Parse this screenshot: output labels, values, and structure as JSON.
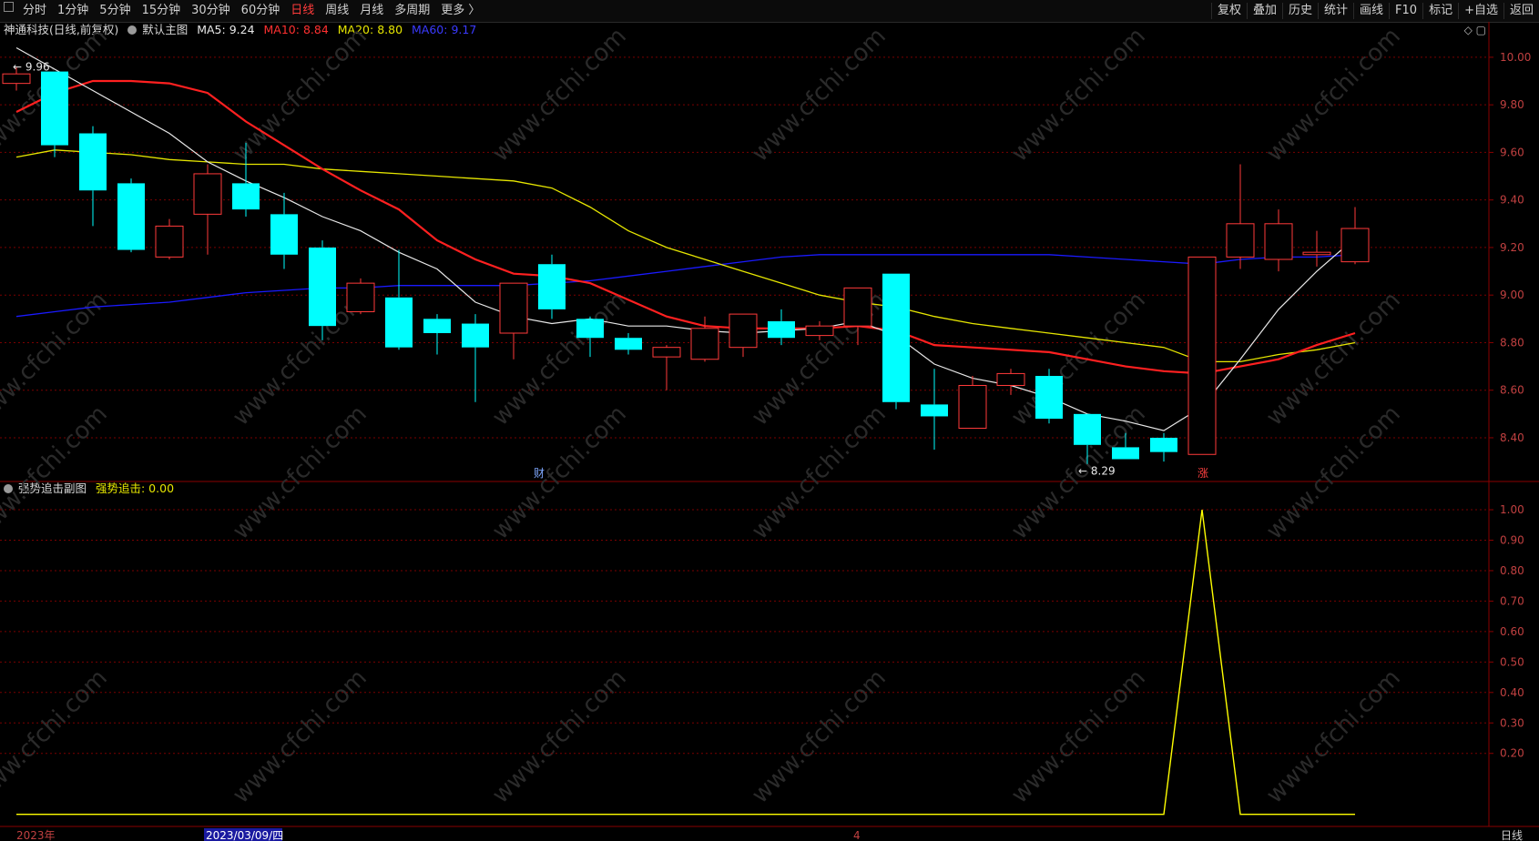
{
  "toolbar": {
    "periods": [
      "分时",
      "1分钟",
      "5分钟",
      "15分钟",
      "30分钟",
      "60分钟",
      "日线",
      "周线",
      "月线",
      "多周期",
      "更多 〉"
    ],
    "active_period": "日线",
    "tools": [
      "复权",
      "叠加",
      "历史",
      "统计",
      "画线",
      "F10",
      "标记",
      "+自选",
      "返回"
    ]
  },
  "main_info": {
    "stock_name": "神通科技(日线,前复权)",
    "indicator_name": "默认主图",
    "ma5": "MA5: 9.24",
    "ma10": "MA10: 8.84",
    "ma20": "MA20: 8.80",
    "ma60": "MA60: 9.17"
  },
  "sub_info": {
    "indicator_name": "强势追击副图",
    "value_label": "强势追击: 0.00"
  },
  "axis": {
    "date_start": "2023年",
    "date_cursor": "2023/03/09/四",
    "month_marker": "4",
    "period_label": "日线"
  },
  "annotations": {
    "high_label": "9.96",
    "low_label": "8.29",
    "finance_marker": "财",
    "limit_up_marker": "涨"
  },
  "watermark": "www.cfchi.com",
  "colors": {
    "up": "#ff3a3a",
    "down": "#00ffff",
    "ma5": "#e8e8e8",
    "ma10": "#ff2020",
    "ma20": "#e6e600",
    "ma60": "#1a1aff",
    "grid": "#7a0000",
    "signal": "#ffff00"
  },
  "chart_data": [
    {
      "type": "candlestick",
      "title": "神通科技(日线,前复权)",
      "y_ticks": [
        "10.00",
        "9.80",
        "9.60",
        "9.40",
        "9.20",
        "9.00",
        "8.80",
        "8.60",
        "8.40"
      ],
      "ylim": [
        8.22,
        10.08
      ],
      "candles": [
        {
          "o": 9.89,
          "c": 9.93,
          "h": 9.96,
          "l": 9.86
        },
        {
          "o": 9.94,
          "c": 9.63,
          "h": 9.94,
          "l": 9.58
        },
        {
          "o": 9.68,
          "c": 9.44,
          "h": 9.71,
          "l": 9.29
        },
        {
          "o": 9.47,
          "c": 9.19,
          "h": 9.49,
          "l": 9.18
        },
        {
          "o": 9.16,
          "c": 9.29,
          "h": 9.32,
          "l": 9.15
        },
        {
          "o": 9.34,
          "c": 9.51,
          "h": 9.55,
          "l": 9.17
        },
        {
          "o": 9.47,
          "c": 9.36,
          "h": 9.64,
          "l": 9.33
        },
        {
          "o": 9.34,
          "c": 9.17,
          "h": 9.43,
          "l": 9.11
        },
        {
          "o": 9.2,
          "c": 8.87,
          "h": 9.23,
          "l": 8.81
        },
        {
          "o": 8.93,
          "c": 9.05,
          "h": 9.07,
          "l": 8.92
        },
        {
          "o": 8.99,
          "c": 8.78,
          "h": 9.19,
          "l": 8.77
        },
        {
          "o": 8.9,
          "c": 8.84,
          "h": 8.92,
          "l": 8.75
        },
        {
          "o": 8.88,
          "c": 8.78,
          "h": 8.92,
          "l": 8.55
        },
        {
          "o": 8.84,
          "c": 9.05,
          "h": 9.05,
          "l": 8.73
        },
        {
          "o": 9.13,
          "c": 8.94,
          "h": 9.17,
          "l": 8.9
        },
        {
          "o": 8.9,
          "c": 8.82,
          "h": 8.91,
          "l": 8.74
        },
        {
          "o": 8.82,
          "c": 8.77,
          "h": 8.84,
          "l": 8.75
        },
        {
          "o": 8.74,
          "c": 8.78,
          "h": 8.79,
          "l": 8.6
        },
        {
          "o": 8.73,
          "c": 8.86,
          "h": 8.91,
          "l": 8.72
        },
        {
          "o": 8.78,
          "c": 8.92,
          "h": 8.92,
          "l": 8.74
        },
        {
          "o": 8.89,
          "c": 8.82,
          "h": 8.94,
          "l": 8.79
        },
        {
          "o": 8.83,
          "c": 8.87,
          "h": 8.89,
          "l": 8.81
        },
        {
          "o": 8.87,
          "c": 9.03,
          "h": 9.03,
          "l": 8.79
        },
        {
          "o": 9.09,
          "c": 8.55,
          "h": 9.09,
          "l": 8.52
        },
        {
          "o": 8.54,
          "c": 8.49,
          "h": 8.69,
          "l": 8.35
        },
        {
          "o": 8.44,
          "c": 8.62,
          "h": 8.66,
          "l": 8.44
        },
        {
          "o": 8.62,
          "c": 8.67,
          "h": 8.69,
          "l": 8.58
        },
        {
          "o": 8.66,
          "c": 8.48,
          "h": 8.69,
          "l": 8.46
        },
        {
          "o": 8.5,
          "c": 8.37,
          "h": 8.5,
          "l": 8.29
        },
        {
          "o": 8.36,
          "c": 8.31,
          "h": 8.42,
          "l": 8.31
        },
        {
          "o": 8.4,
          "c": 8.34,
          "h": 8.42,
          "l": 8.3
        },
        {
          "o": 8.33,
          "c": 9.16,
          "h": 9.16,
          "l": 8.33
        },
        {
          "o": 9.16,
          "c": 9.3,
          "h": 9.55,
          "l": 9.11
        },
        {
          "o": 9.15,
          "c": 9.3,
          "h": 9.36,
          "l": 9.1
        },
        {
          "o": 9.17,
          "c": 9.18,
          "h": 9.27,
          "l": 9.12
        },
        {
          "o": 9.14,
          "c": 9.28,
          "h": 9.37,
          "l": 9.13
        }
      ],
      "ma5": [
        10.04,
        9.95,
        9.86,
        9.77,
        9.68,
        9.56,
        9.48,
        9.41,
        9.33,
        9.27,
        9.18,
        9.11,
        8.97,
        8.91,
        8.88,
        8.9,
        8.87,
        8.87,
        8.85,
        8.84,
        8.85,
        8.86,
        8.89,
        8.83,
        8.71,
        8.65,
        8.62,
        8.57,
        8.5,
        8.47,
        8.43,
        8.53,
        8.73,
        8.94,
        9.1,
        9.24
      ],
      "ma10": [
        9.77,
        9.85,
        9.9,
        9.9,
        9.89,
        9.85,
        9.73,
        9.63,
        9.53,
        9.44,
        9.36,
        9.23,
        9.15,
        9.09,
        9.08,
        9.05,
        8.98,
        8.91,
        8.87,
        8.86,
        8.86,
        8.86,
        8.87,
        8.85,
        8.79,
        8.78,
        8.77,
        8.76,
        8.73,
        8.7,
        8.68,
        8.67,
        8.7,
        8.73,
        8.79,
        8.84
      ],
      "ma20": [
        9.58,
        9.61,
        9.6,
        9.59,
        9.57,
        9.56,
        9.55,
        9.55,
        9.53,
        9.52,
        9.51,
        9.5,
        9.49,
        9.48,
        9.45,
        9.37,
        9.27,
        9.2,
        9.15,
        9.1,
        9.05,
        9.0,
        8.97,
        8.95,
        8.91,
        8.88,
        8.86,
        8.84,
        8.82,
        8.8,
        8.78,
        8.72,
        8.72,
        8.75,
        8.77,
        8.8
      ],
      "ma60": [
        8.91,
        8.93,
        8.95,
        8.96,
        8.97,
        8.99,
        9.01,
        9.02,
        9.03,
        9.03,
        9.04,
        9.04,
        9.04,
        9.04,
        9.05,
        9.06,
        9.08,
        9.1,
        9.12,
        9.14,
        9.16,
        9.17,
        9.17,
        9.17,
        9.17,
        9.17,
        9.17,
        9.17,
        9.16,
        9.15,
        9.14,
        9.13,
        9.15,
        9.16,
        9.16,
        9.17
      ]
    },
    {
      "type": "line",
      "title": "强势追击副图",
      "y_ticks": [
        "1.00",
        "0.90",
        "0.80",
        "0.70",
        "0.60",
        "0.50",
        "0.40",
        "0.30",
        "0.20"
      ],
      "ylim": [
        -0.01,
        1.03
      ],
      "series": [
        {
          "name": "强势追击",
          "values": [
            0,
            0,
            0,
            0,
            0,
            0,
            0,
            0,
            0,
            0,
            0,
            0,
            0,
            0,
            0,
            0,
            0,
            0,
            0,
            0,
            0,
            0,
            0,
            0,
            0,
            0,
            0,
            0,
            0,
            0,
            0,
            1,
            0,
            0,
            0,
            0
          ]
        }
      ]
    }
  ]
}
